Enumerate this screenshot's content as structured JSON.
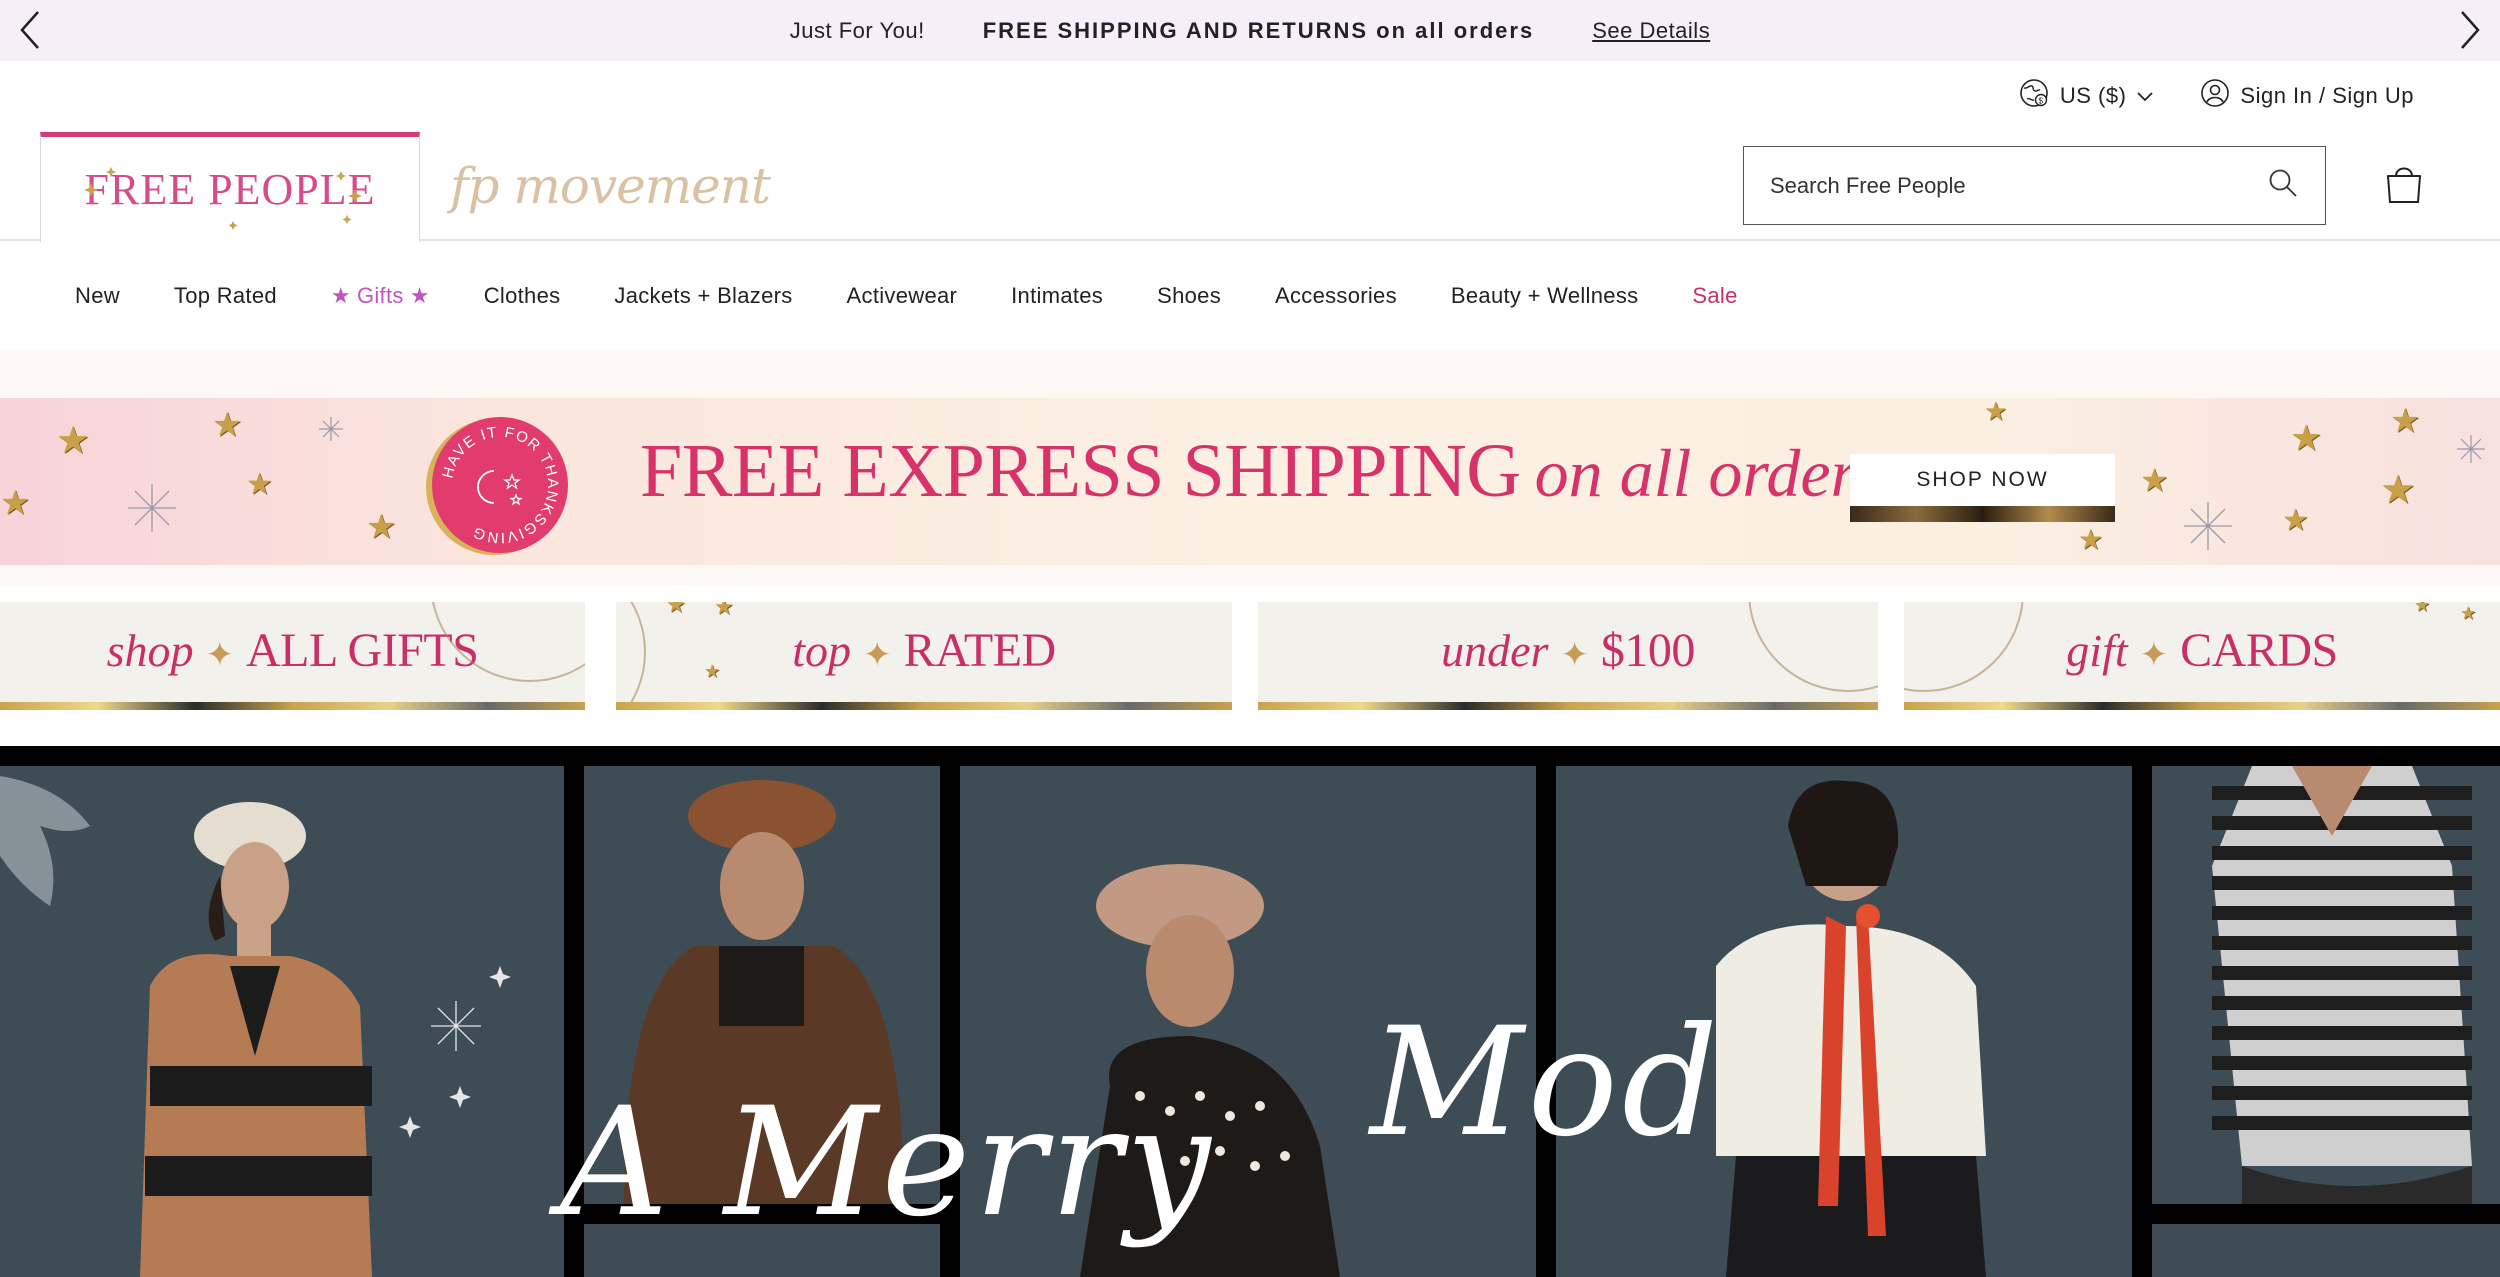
{
  "promo": {
    "just_for_you": "Just For You!",
    "message": "FREE SHIPPING AND RETURNS on all orders",
    "details_link": "See Details",
    "prev_icon": "chevron-left-icon",
    "next_icon": "chevron-right-icon"
  },
  "utility": {
    "currency_label": "US ($)",
    "signin_label": "Sign In / Sign Up"
  },
  "brands": {
    "free_people": "FREE PEOPLE",
    "fp_movement": "fp movement",
    "accent": "#d13d7a"
  },
  "search": {
    "placeholder": "Search Free People"
  },
  "nav": {
    "items": [
      {
        "label": "New"
      },
      {
        "label": "Top Rated"
      },
      {
        "label": "Gifts"
      },
      {
        "label": "Clothes"
      },
      {
        "label": "Jackets + Blazers"
      },
      {
        "label": "Activewear"
      },
      {
        "label": "Intimates"
      },
      {
        "label": "Shoes"
      },
      {
        "label": "Accessories"
      },
      {
        "label": "Beauty + Wellness"
      },
      {
        "label": "Sale"
      }
    ],
    "gifts_color": "#c255c0",
    "sale_color": "#c4306d"
  },
  "shipping_banner": {
    "badge_text": "HAVE IT FOR THANKSGIVING",
    "headline_caps": "FREE EXPRESS SHIPPING",
    "headline_italic": "on all orders",
    "cta": "SHOP NOW",
    "text_color": "#d7336a"
  },
  "category_tiles": [
    {
      "italic": "shop",
      "caps": "ALL GIFTS"
    },
    {
      "italic": "top",
      "caps": "RATED"
    },
    {
      "italic": "under",
      "caps": "$100"
    },
    {
      "italic": "gift",
      "caps": "CARDS"
    }
  ],
  "hero": {
    "script_line_1a": "A Merry",
    "script_line_1b": "Mod"
  }
}
